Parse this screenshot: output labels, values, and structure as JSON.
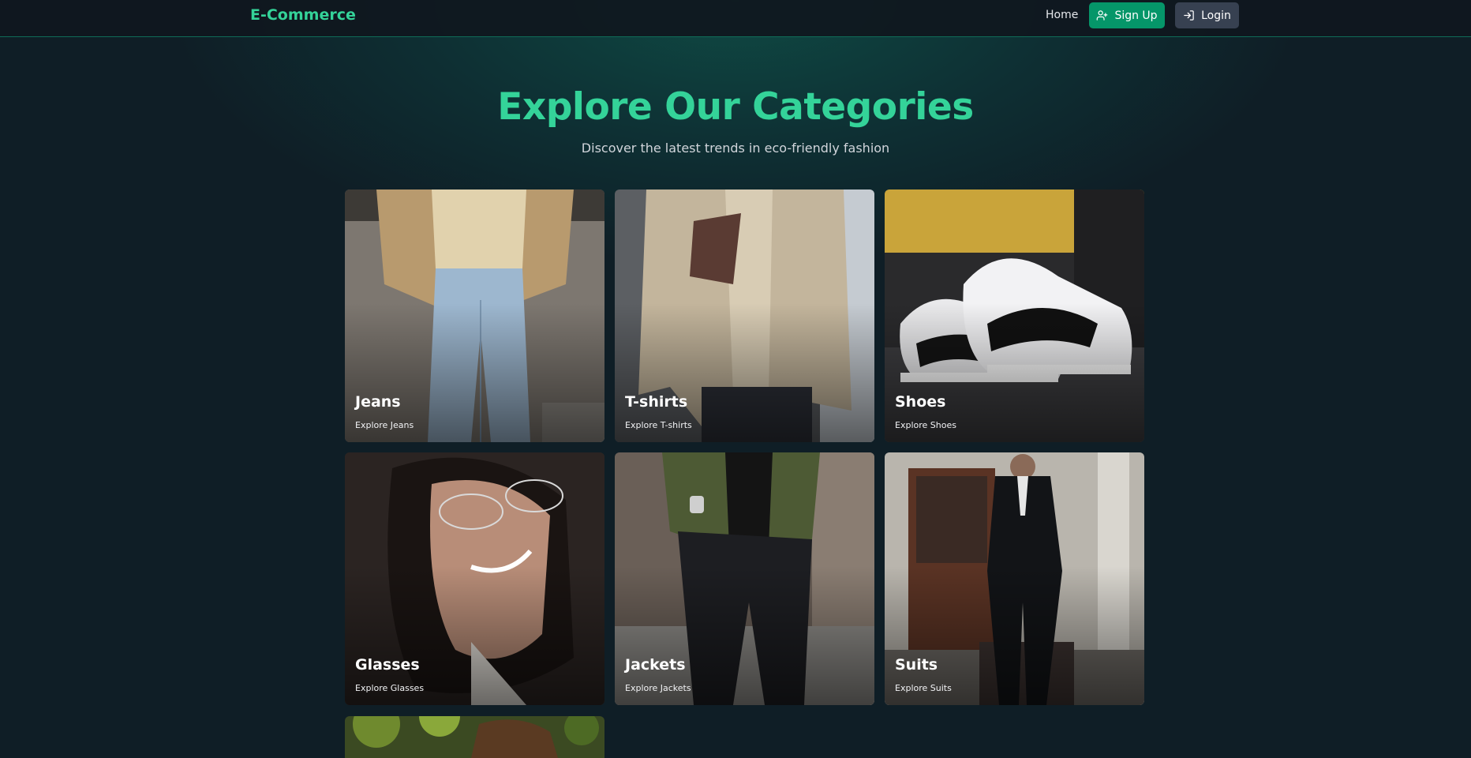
{
  "nav": {
    "brand": "E-Commerce",
    "home": "Home",
    "signup": "Sign Up",
    "login": "Login",
    "signup_icon": "user-plus-icon",
    "login_icon": "log-in-icon"
  },
  "hero": {
    "title": "Explore Our Categories",
    "subtitle": "Discover the latest trends in eco-friendly fashion"
  },
  "categories": [
    {
      "title": "Jeans",
      "subtitle": "Explore Jeans"
    },
    {
      "title": "T-shirts",
      "subtitle": "Explore T-shirts"
    },
    {
      "title": "Shoes",
      "subtitle": "Explore Shoes"
    },
    {
      "title": "Glasses",
      "subtitle": "Explore Glasses"
    },
    {
      "title": "Jackets",
      "subtitle": "Explore Jackets"
    },
    {
      "title": "Suits",
      "subtitle": "Explore Suits"
    }
  ],
  "colors": {
    "accent": "#34d399",
    "signup_bg": "#059669",
    "login_bg": "#374151",
    "page_bg": "#0f1e26"
  }
}
